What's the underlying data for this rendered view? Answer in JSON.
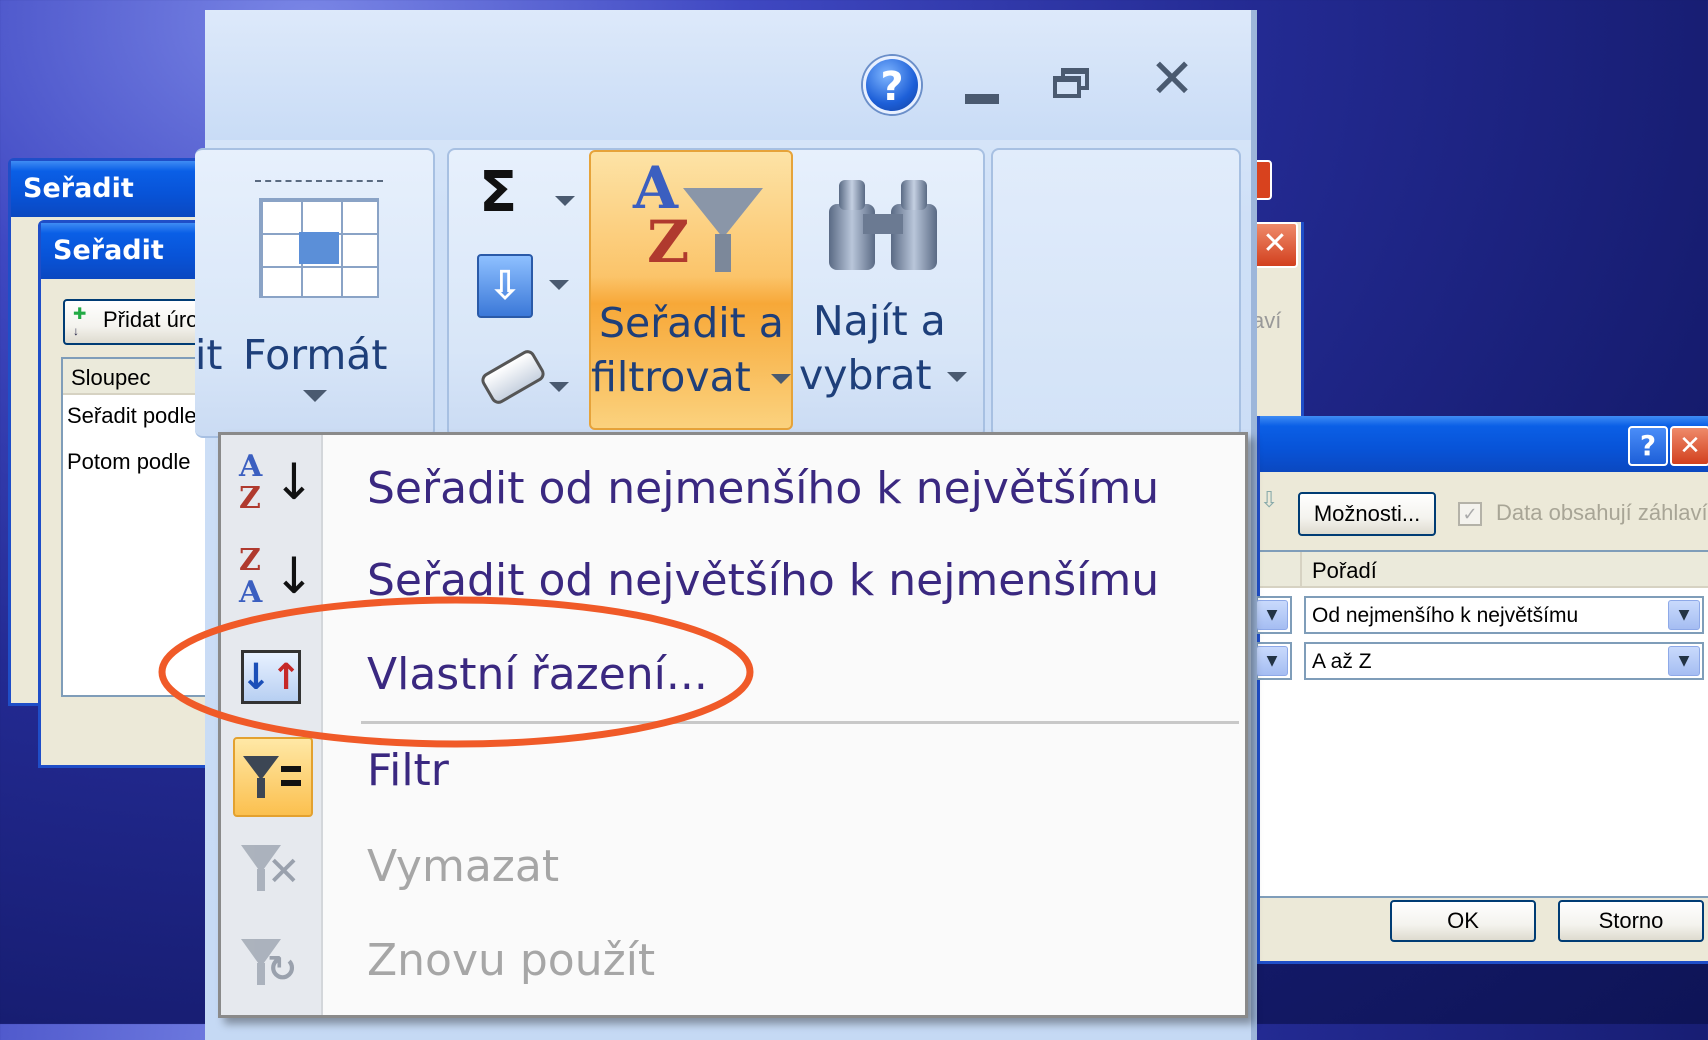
{
  "dialog_back": {
    "title": "Seřadit"
  },
  "dialog_front": {
    "title": "Seřadit",
    "add_level_label": "Přidat úro",
    "grid": {
      "column_header": "Sloupec",
      "rows": [
        "Seřadit podle",
        "Potom podle"
      ]
    }
  },
  "ribbon": {
    "format_label_1": "it",
    "format_label_2": "Formát",
    "sort_filter": {
      "line1": "Seřadit a",
      "line2": "filtrovat"
    },
    "find_select": {
      "line1": "Najít a",
      "line2": "vybrat"
    },
    "icons": {
      "sum": "Σ",
      "help": "?"
    }
  },
  "menu": {
    "items": [
      {
        "label": "Seřadit od nejmenšího k největšímu",
        "icon": "sort-ascending-icon",
        "enabled": true
      },
      {
        "label": "Seřadit od největšího k nejmenšímu",
        "icon": "sort-descending-icon",
        "enabled": true
      },
      {
        "label": "Vlastní řazení...",
        "icon": "custom-sort-icon",
        "enabled": true,
        "highlighted_annotation": true
      },
      {
        "label": "Filtr",
        "icon": "filter-icon",
        "enabled": true,
        "active": true
      },
      {
        "label": "Vymazat",
        "icon": "clear-filter-icon",
        "enabled": false
      },
      {
        "label": "Znovu použít",
        "icon": "reapply-filter-icon",
        "enabled": false
      }
    ]
  },
  "right_dialog": {
    "partial_text": "aví",
    "options_button": "Možnosti...",
    "header_checkbox_label": "Data obsahují záhlaví",
    "order_header": "Pořadí",
    "order_values": [
      "Od nejmenšího k největšímu",
      "A až Z"
    ],
    "ok_label": "OK",
    "cancel_label": "Storno",
    "title_buttons": {
      "help": "?",
      "close": "✕"
    }
  },
  "colors": {
    "annotation_ellipse": "#f05a28",
    "menu_text": "#3a2880",
    "disabled_text": "#a6a6a6",
    "xp_title_blue": "#0853d7",
    "sort_button_highlight": "#f7b54a"
  }
}
